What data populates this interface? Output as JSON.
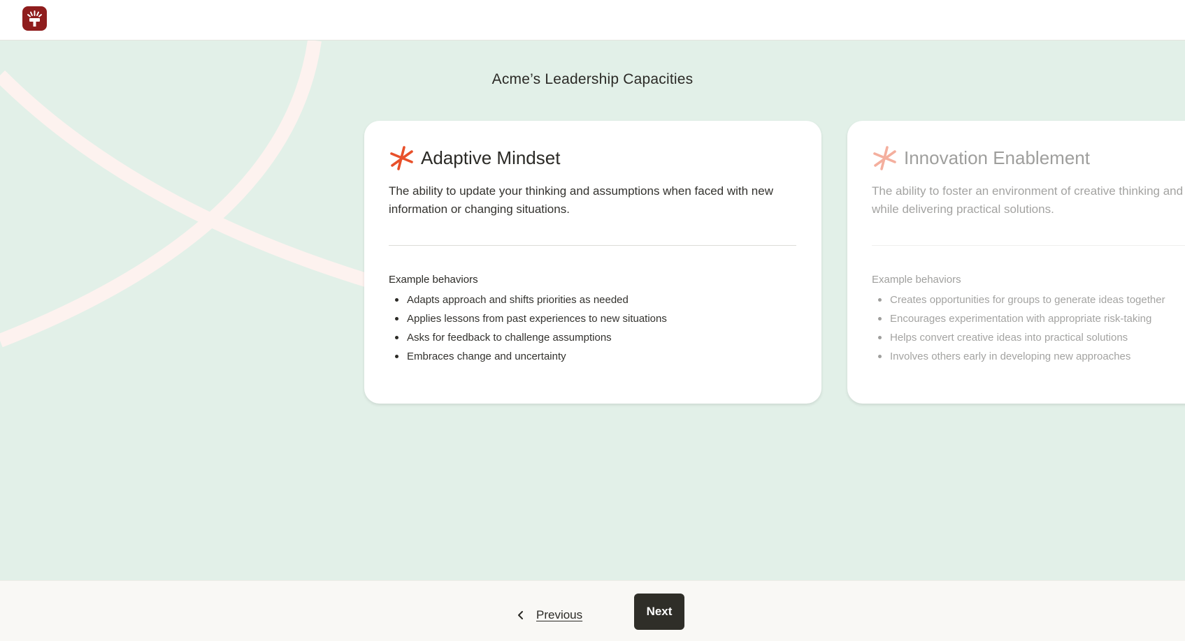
{
  "header": {
    "logo_icon": "brand-logo-icon",
    "logo_color": "#8f1d1d"
  },
  "page": {
    "title": "Acme’s Leadership Capacities"
  },
  "colors": {
    "background": "#e2f0e8",
    "accent": "#e8502a",
    "button_dark": "#2f2e28"
  },
  "cards": [
    {
      "icon": "asterisk-star-icon",
      "title": "Adaptive Mindset",
      "description": "The ability to update your thinking and assumptions when faced with new information or changing situations.",
      "behaviors_label": "Example behaviors",
      "behaviors": [
        "Adapts approach and shifts priorities as needed",
        "Applies lessons from past experiences to new situations",
        "Asks for feedback to challenge assumptions",
        "Embraces change and uncertainty"
      ]
    },
    {
      "icon": "asterisk-star-icon",
      "title": "Innovation Enablement",
      "description": "The ability to foster an environment of creative thinking and experimentation while delivering practical solutions.",
      "behaviors_label": "Example behaviors",
      "behaviors": [
        "Creates opportunities for groups to generate ideas together",
        "Encourages experimentation with appropriate risk-taking",
        "Helps convert creative ideas into practical solutions",
        "Involves others early in developing new approaches"
      ]
    }
  ],
  "footer": {
    "previous_label": "Previous",
    "next_label": "Next",
    "previous_icon": "chevron-left-icon"
  }
}
